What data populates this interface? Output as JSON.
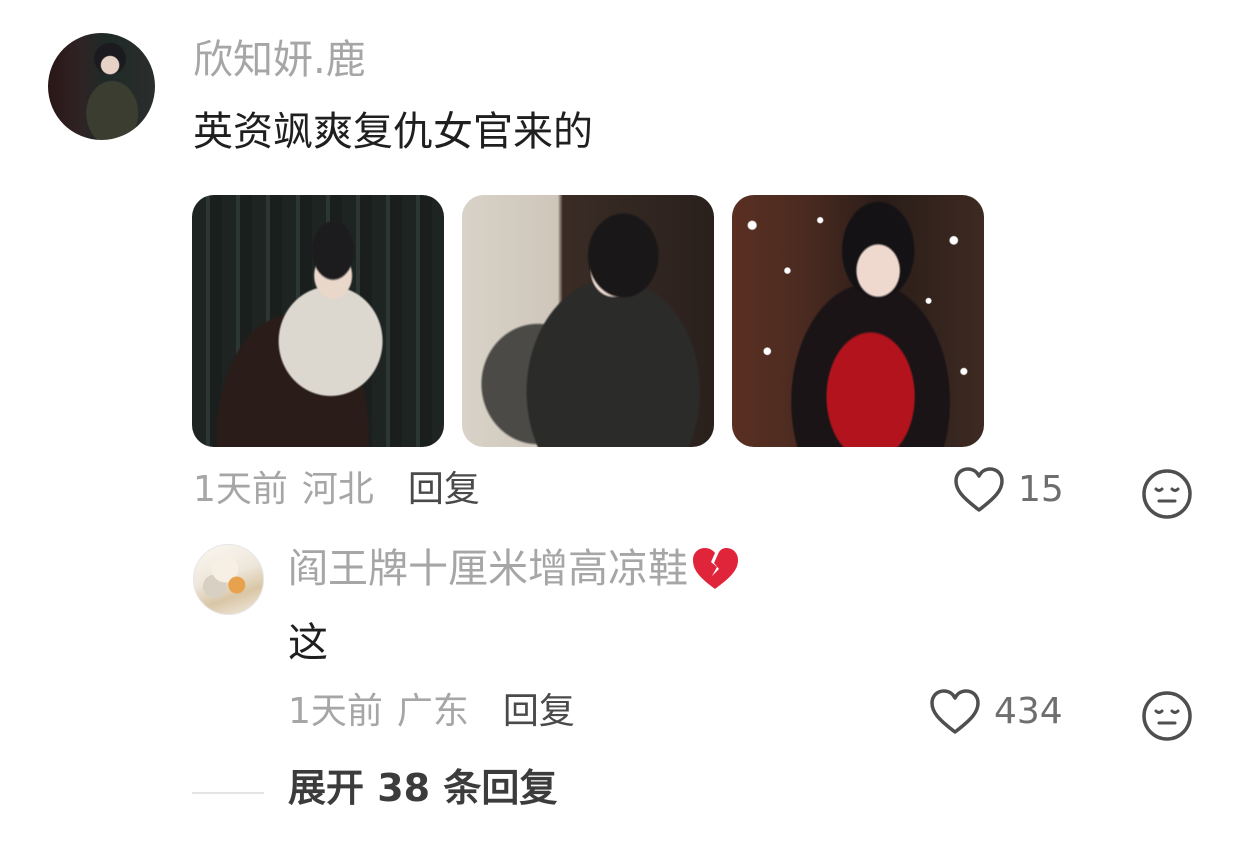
{
  "comment": {
    "username": "欣知妍.鹿",
    "text": "英资飒爽复仇女官来的",
    "time": "1天前",
    "location": "河北",
    "reply_label": "回复",
    "like_count": "15",
    "images": [
      "photo-1",
      "photo-2",
      "photo-3"
    ]
  },
  "reply": {
    "username": "阎王牌十厘米增高凉鞋",
    "username_emoji": "broken-heart-icon",
    "text": "这",
    "time": "1天前",
    "location": "广东",
    "reply_label": "回复",
    "like_count": "434"
  },
  "expand_replies": "展开 38 条回复",
  "colors": {
    "username": "#a6a6a6",
    "text": "#1f1f1f",
    "broken_heart": "#e0243a"
  }
}
